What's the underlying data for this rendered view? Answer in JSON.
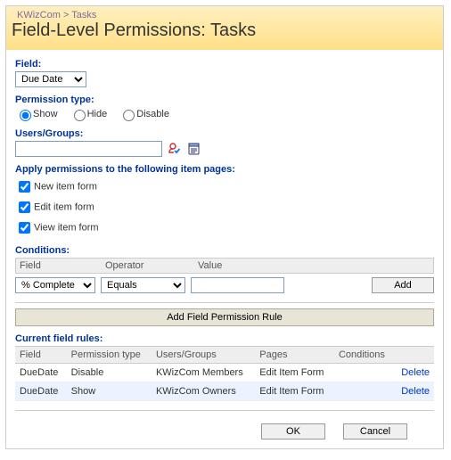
{
  "breadcrumb": "KWizCom > Tasks",
  "page_title": "Field-Level Permissions: Tasks",
  "labels": {
    "field": "Field:",
    "permission_type": "Permission type:",
    "users_groups": "Users/Groups:",
    "apply_pages": "Apply permissions to the following item pages:",
    "conditions": "Conditions:",
    "current_rules": "Current field rules:"
  },
  "field_select": {
    "options": [
      "Due Date"
    ],
    "selected": "Due Date"
  },
  "permission_type": {
    "options": [
      "Show",
      "Hide",
      "Disable"
    ],
    "selected": "Show"
  },
  "users_groups": {
    "value": ""
  },
  "icons": {
    "check_names": "check-names-icon",
    "browse": "address-book-icon"
  },
  "item_pages": [
    {
      "label": "New item form",
      "checked": true
    },
    {
      "label": "Edit item form",
      "checked": true
    },
    {
      "label": "View item form",
      "checked": true
    }
  ],
  "conditions": {
    "headers": {
      "field": "Field",
      "operator": "Operator",
      "value": "Value"
    },
    "field_options": [
      "% Complete"
    ],
    "field_selected": "% Complete",
    "operator_options": [
      "Equals"
    ],
    "operator_selected": "Equals",
    "value": "",
    "add_label": "Add"
  },
  "add_rule_label": "Add Field Permission Rule",
  "rules_table": {
    "headers": {
      "field": "Field",
      "permission_type": "Permission type",
      "users_groups": "Users/Groups",
      "pages": "Pages",
      "conditions": "Conditions"
    },
    "rows": [
      {
        "field": "DueDate",
        "permission_type": "Disable",
        "users_groups": "KWizCom Members",
        "pages": "Edit Item Form",
        "conditions": "",
        "action": "Delete"
      },
      {
        "field": "DueDate",
        "permission_type": "Show",
        "users_groups": "KWizCom Owners",
        "pages": "Edit Item Form",
        "conditions": "",
        "action": "Delete"
      }
    ]
  },
  "footer": {
    "ok": "OK",
    "cancel": "Cancel"
  }
}
